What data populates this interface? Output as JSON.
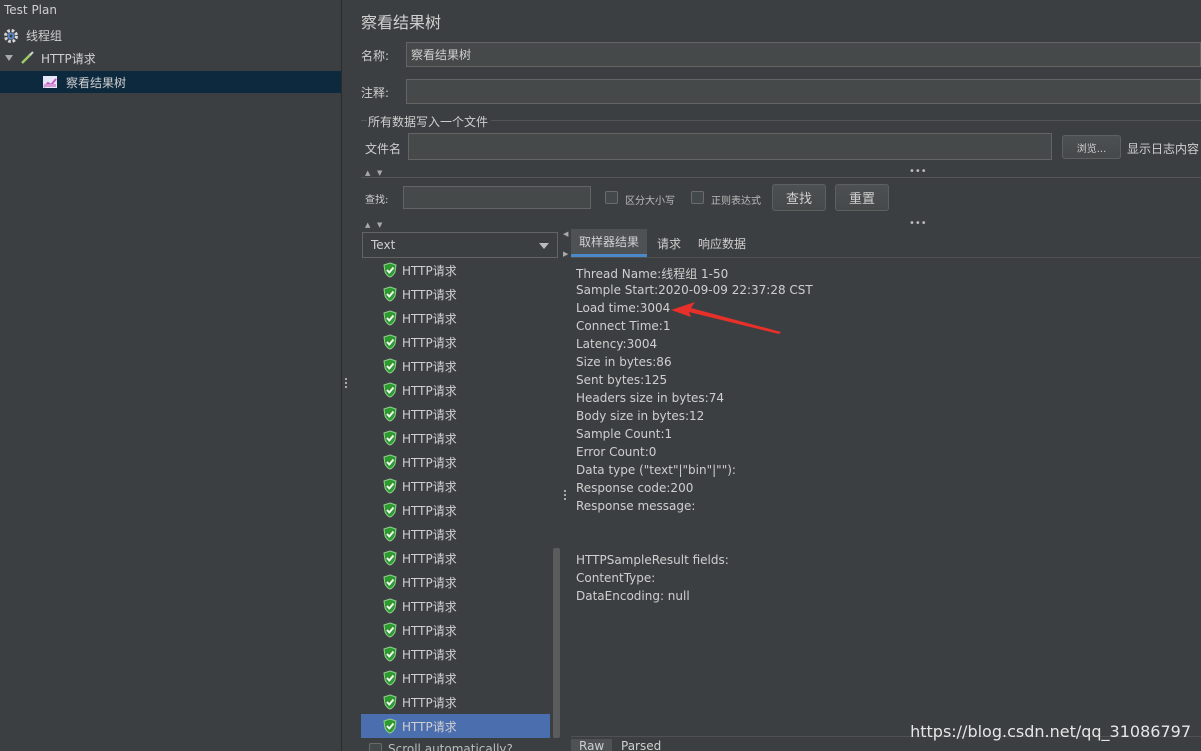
{
  "tree": {
    "root": "Test Plan",
    "thread_group": "线程组",
    "http_request": "HTTP请求",
    "listener": "察看结果树"
  },
  "main": {
    "title": "察看结果树",
    "name_label": "名称:",
    "name_value": "察看结果树",
    "comment_label": "注释:",
    "comment_value": "",
    "file_group_title": "所有数据写入一个文件",
    "filename_label": "文件名",
    "filename_value": "",
    "browse_button": "浏览...",
    "log_content_label": "显示日志内容"
  },
  "search": {
    "label": "查找:",
    "value": "",
    "case_sensitive": "区分大小写",
    "regex": "正则表达式",
    "find_button": "查找",
    "reset_button": "重置"
  },
  "results": {
    "renderer": "Text",
    "items": [
      "HTTP请求",
      "HTTP请求",
      "HTTP请求",
      "HTTP请求",
      "HTTP请求",
      "HTTP请求",
      "HTTP请求",
      "HTTP请求",
      "HTTP请求",
      "HTTP请求",
      "HTTP请求",
      "HTTP请求",
      "HTTP请求",
      "HTTP请求",
      "HTTP请求",
      "HTTP请求",
      "HTTP请求",
      "HTTP请求",
      "HTTP请求",
      "HTTP请求"
    ],
    "scroll_automatically": "Scroll automatically?"
  },
  "tabs": {
    "sampler_result": "取样器结果",
    "request": "请求",
    "response_data": "响应数据"
  },
  "detail_lines": [
    "Thread Name:线程组 1-50",
    "Sample Start:2020-09-09 22:37:28 CST",
    "Load time:3004",
    "Connect Time:1",
    "Latency:3004",
    "Size in bytes:86",
    "Sent bytes:125",
    "Headers size in bytes:74",
    "Body size in bytes:12",
    "Sample Count:1",
    "Error Count:0",
    "Data type (\"text\"|\"bin\"|\"\"):",
    "Response code:200",
    "Response message:",
    "HTTPSampleResult fields:",
    "ContentType:",
    "DataEncoding: null"
  ],
  "bottom_tabs": {
    "raw": "Raw",
    "parsed": "Parsed"
  },
  "watermark": "https://blog.csdn.net/qq_31086797",
  "colors": {
    "background": "#3c3f41",
    "selection": "#4b6eaf",
    "arrow": "#e8302a",
    "success_icon": "#3fae3f"
  }
}
